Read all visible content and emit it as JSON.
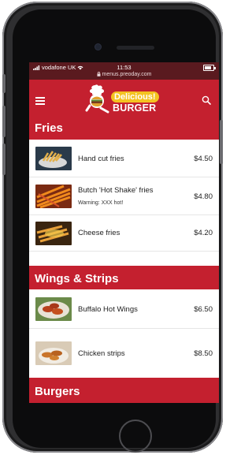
{
  "status_bar": {
    "carrier": "vodafone UK",
    "time": "11:53",
    "url": "menus.preoday.com"
  },
  "header": {
    "logo_top": "Delicious!",
    "logo_bottom": "BURGER",
    "brand_color": "#c4202f",
    "accent_color": "#f4c321"
  },
  "sections": [
    {
      "title": "Fries",
      "items": [
        {
          "name": "Hand cut fries",
          "price": "$4.50"
        },
        {
          "name": "Butch 'Hot Shake' fries",
          "warning": "Warning: XXX hot!",
          "price": "$4.80"
        },
        {
          "name": "Cheese fries",
          "price": "$4.20"
        }
      ]
    },
    {
      "title": "Wings & Strips",
      "items": [
        {
          "name": "Buffalo Hot Wings",
          "price": "$6.50"
        },
        {
          "name": "Chicken strips",
          "price": "$8.50"
        }
      ]
    },
    {
      "title": "Burgers",
      "items": []
    }
  ]
}
